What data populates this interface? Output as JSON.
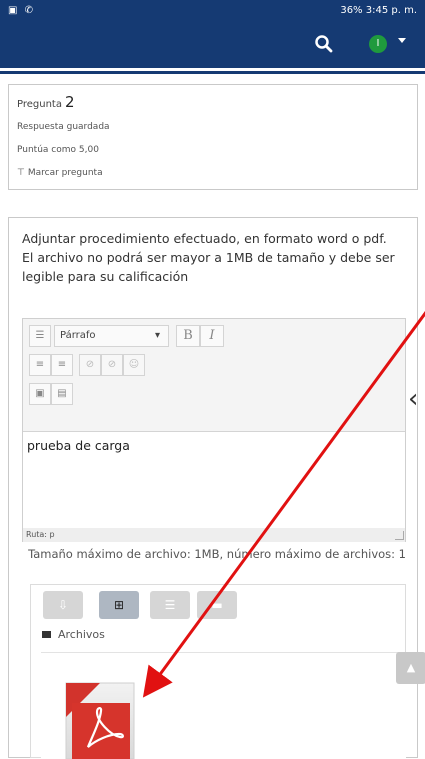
{
  "status_bar": {
    "left_icons": "▣ ✆",
    "right_text": "36% 3:45 p. m."
  },
  "app_bar": {
    "avatar_letter": "I"
  },
  "question_info": {
    "label": "Pregunta",
    "number": "2",
    "status": "Respuesta guardada",
    "score": "Puntúa como 5,00",
    "flag": "Marcar pregunta"
  },
  "question": {
    "text": "Adjuntar procedimiento efectuado, en formato word o pdf. El archivo no podrá ser mayor a 1MB de tamaño y debe ser legible para su calificación"
  },
  "editor": {
    "paragraph_select": "Párrafo",
    "bold": "B",
    "italic": "I",
    "content": "prueba de carga",
    "path": "Ruta: p"
  },
  "upload": {
    "limit_text": "Tamaño máximo de archivo: 1MB, número máximo de archivos: 1",
    "folder_label": "Archivos"
  },
  "colors": {
    "brand": "#153a73",
    "annotation_arrow": "#e11111"
  }
}
